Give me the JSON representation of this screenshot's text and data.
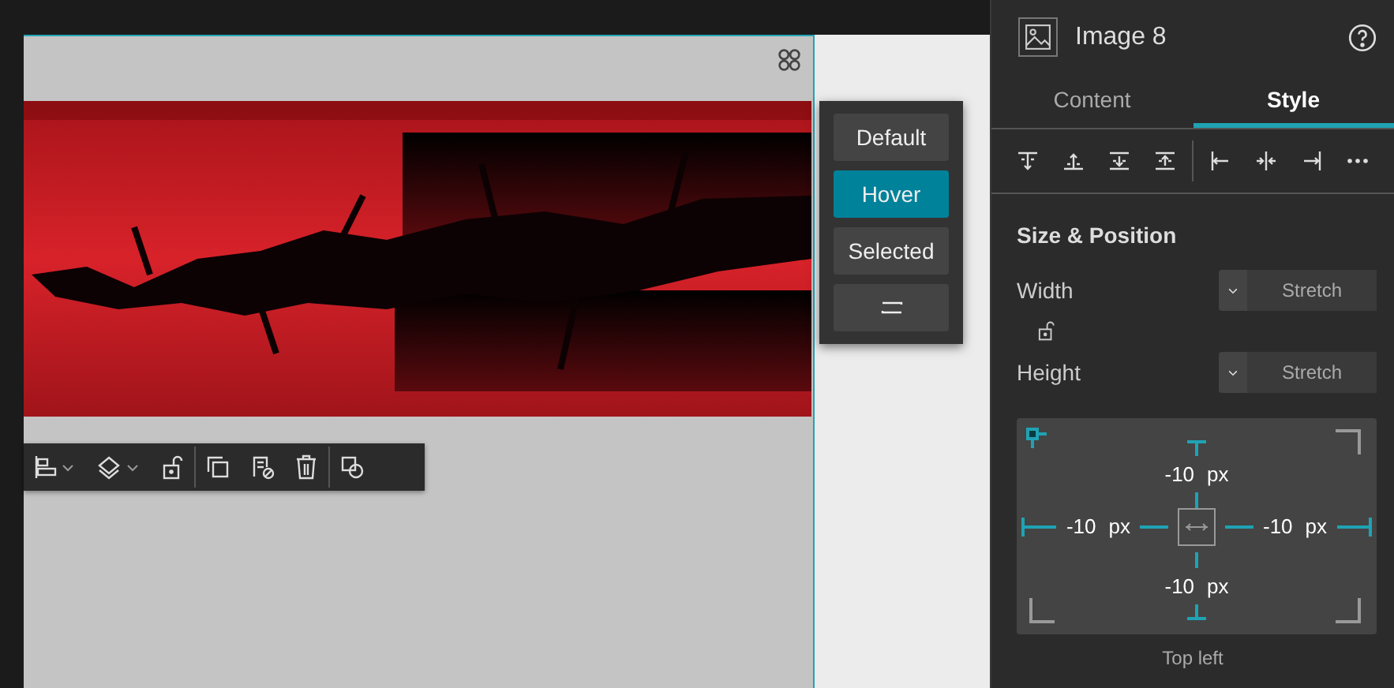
{
  "states": [
    {
      "label": "Default",
      "selected": false
    },
    {
      "label": "Hover",
      "selected": true
    },
    {
      "label": "Selected",
      "selected": false
    }
  ],
  "panel": {
    "title": "Image 8",
    "tabs": [
      {
        "label": "Content",
        "selected": false
      },
      {
        "label": "Style",
        "selected": true
      }
    ],
    "section": "Size & Position",
    "fields": [
      {
        "label": "Width",
        "value": "Stretch"
      },
      {
        "label": "Height",
        "value": "Stretch"
      }
    ],
    "offsets": {
      "top": {
        "value": "-10",
        "unit": "px"
      },
      "left": {
        "value": "-10",
        "unit": "px"
      },
      "right": {
        "value": "-10",
        "unit": "px"
      },
      "bottom": {
        "value": "-10",
        "unit": "px"
      }
    },
    "anchor_label": "Top left"
  }
}
